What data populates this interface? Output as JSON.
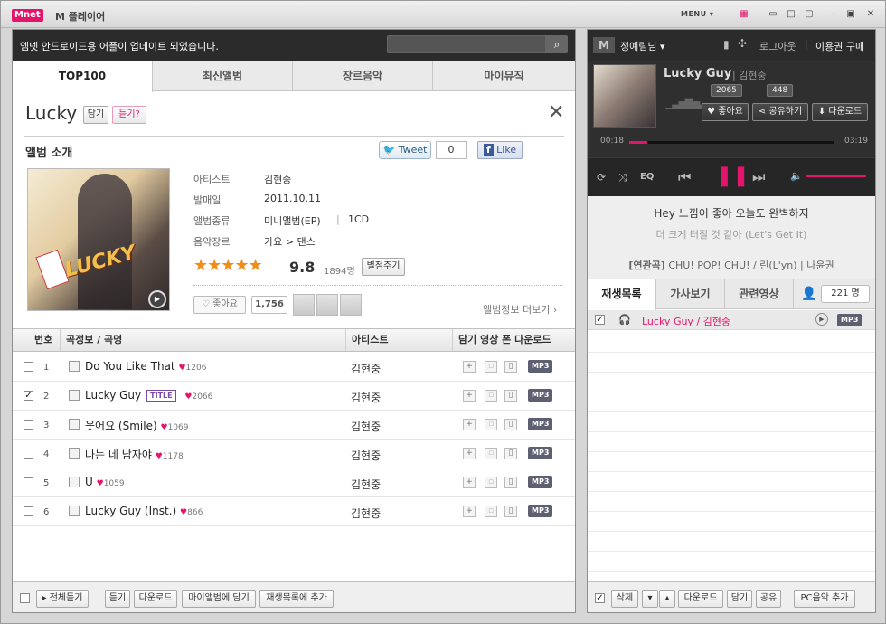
{
  "app": {
    "logo": "Mnet",
    "title": "M 플레이어",
    "menu_label": "MENU"
  },
  "notice": {
    "text": "엠넷 안드로이드용 어플이 업데이트 되었습니다."
  },
  "tabs": [
    {
      "label": "TOP100"
    },
    {
      "label": "최신앨범"
    },
    {
      "label": "장르음악"
    },
    {
      "label": "마이뮤직"
    }
  ],
  "album": {
    "title": "Lucky",
    "add_label": "담기",
    "gift_label": "듣기?",
    "section_title": "앨범 소개",
    "tweet_label": "Tweet",
    "tweet_count": "0",
    "fb_like_label": "Like",
    "cover_text": "LUCKY",
    "artist_label": "아티스트",
    "artist_value": "김현중",
    "release_label": "발매일",
    "release_value": "2011.10.11",
    "type_label": "앨범종류",
    "type_value": "미니앨범(EP)",
    "type_extra": "1CD",
    "genre_label": "음악장르",
    "genre_value": "가요 > 댄스",
    "stars": "★★★★★",
    "rating": "9.8",
    "rating_count": "1894명",
    "rate_button": "별점주기",
    "like_label": "♡ 좋아요",
    "like_count": "1,756",
    "more_info": "앨범정보 더보기 ›"
  },
  "table": {
    "headers": {
      "num": "번호",
      "info": "곡정보 / 곡명",
      "artist": "아티스트",
      "actions": "담기 영상 폰 다운로드"
    },
    "rows": [
      {
        "num": "1",
        "title": "Do You Like That",
        "likes": "1206",
        "artist": "김현중",
        "checked": false,
        "title_badge": false
      },
      {
        "num": "2",
        "title": "Lucky Guy",
        "likes": "2066",
        "artist": "김현중",
        "checked": true,
        "title_badge": true
      },
      {
        "num": "3",
        "title": "웃어요 (Smile)",
        "likes": "1069",
        "artist": "김현중",
        "checked": false,
        "title_badge": false
      },
      {
        "num": "4",
        "title": "나는 네 남자야",
        "likes": "1178",
        "artist": "김현중",
        "checked": false,
        "title_badge": false
      },
      {
        "num": "5",
        "title": "U",
        "likes": "1059",
        "artist": "김현중",
        "checked": false,
        "title_badge": false
      },
      {
        "num": "6",
        "title": "Lucky Guy (Inst.)",
        "likes": "866",
        "artist": "김현중",
        "checked": false,
        "title_badge": false
      }
    ],
    "title_badge_text": "TITLE",
    "mp3": "MP3",
    "heart": "♥"
  },
  "bottom": {
    "play_all": "▸ 전체듣기",
    "listen": "듣기",
    "download": "다운로드",
    "add_my_album": "마이앨범에 담기",
    "add_playlist": "재생목록에 추가"
  },
  "user": {
    "name": "정예림님 ▾",
    "logout": "로그아웃",
    "buy": "이용권 구매"
  },
  "player": {
    "title": "Lucky Guy",
    "artist": "김현중",
    "like_label": "♥ 좋아요",
    "like_count": "2065",
    "share_label": "공유하기",
    "share_count": "448",
    "download_label": "⬇ 다운로드",
    "elapsed": "00:18",
    "total": "03:19",
    "progress": 0.09,
    "volume": 1.0,
    "eq": "EQ"
  },
  "lyrics": {
    "line1": "Hey 느낌이 좋아 오늘도 완벽하지",
    "line2": "더 크게 터질 것 같아 (Let's Get It)",
    "related_label": "[연관곡]",
    "related_songs": "CHU! POP! CHU! / 린(L'yn) | 나윤권"
  },
  "right_tabs": [
    {
      "label": "재생목록"
    },
    {
      "label": "가사보기"
    },
    {
      "label": "관련영상"
    }
  ],
  "listeners": "221 명",
  "playlist": [
    {
      "text": "Lucky Guy / 김현중",
      "checked": true
    }
  ],
  "right_bottom": {
    "delete": "삭제",
    "download": "다운로드",
    "add": "담기",
    "share": "공유",
    "pc_add": "PC음악 추가"
  },
  "colors": {
    "accent": "#e4146c",
    "dark": "#2b2b2b"
  }
}
